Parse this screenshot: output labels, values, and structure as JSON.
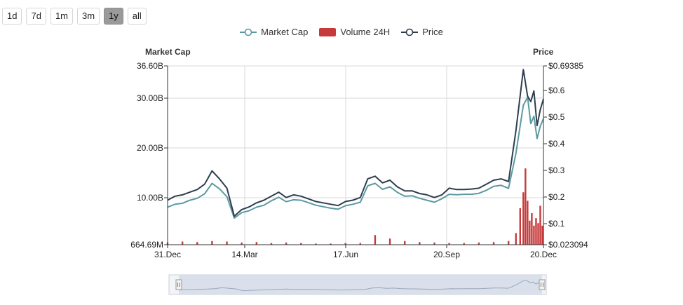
{
  "range_selector": {
    "buttons": [
      "1d",
      "7d",
      "1m",
      "3m",
      "1y",
      "all"
    ],
    "active": "1y"
  },
  "colors": {
    "market_cap": "#5b9aa0",
    "price": "#2e3d4f",
    "volume": "#c8393b",
    "grid": "#d8d8d8",
    "navigator_fill": "#d7dee9"
  },
  "chart_data": {
    "type": "line",
    "left_axis_title": "Market Cap",
    "right_axis_title": "Price",
    "x_ticks": [
      "31.Dec",
      "14.Mar",
      "17.Jun",
      "20.Sep",
      "20.Dec"
    ],
    "left_ticks": [
      "36.60B",
      "30.00B",
      "20.00B",
      "10.00B",
      "664.69M"
    ],
    "right_ticks": [
      "$0.69385",
      "$0.6",
      "$0.5",
      "$0.4",
      "$0.3",
      "$0.2",
      "$0.1",
      "$0.023094"
    ],
    "ylim_market_cap_billions": [
      0.66469,
      36.6
    ],
    "ylim_price_usd": [
      0.023094,
      0.69385
    ],
    "grid": true,
    "legend_position": "top-center",
    "series": [
      {
        "name": "Market Cap",
        "axis": "left",
        "unit": "B",
        "x_day": [
          0,
          7,
          14,
          21,
          28,
          35,
          42,
          49,
          56,
          63,
          70,
          77,
          84,
          91,
          98,
          105,
          112,
          119,
          126,
          133,
          140,
          147,
          154,
          161,
          168,
          175,
          182,
          189,
          196,
          203,
          210,
          217,
          224,
          231,
          238,
          245,
          252,
          259,
          266,
          273,
          280,
          287,
          294,
          301,
          308,
          315,
          322,
          329,
          336,
          340,
          343,
          346,
          349,
          352,
          355
        ],
        "values": [
          8.2,
          8.8,
          9.0,
          9.6,
          10.0,
          10.9,
          13.0,
          11.9,
          10.3,
          6.0,
          7.1,
          7.5,
          8.2,
          8.6,
          9.5,
          10.2,
          9.3,
          9.7,
          9.6,
          9.1,
          8.6,
          8.3,
          8.0,
          7.8,
          8.5,
          8.8,
          9.2,
          12.5,
          13.0,
          11.8,
          12.3,
          11.2,
          10.4,
          10.5,
          10.0,
          9.6,
          9.2,
          9.9,
          10.8,
          10.7,
          10.8,
          10.8,
          11.0,
          11.6,
          12.4,
          12.6,
          12.0,
          19.0,
          28.7,
          30.3,
          25.0,
          26.5,
          22.0,
          24.5,
          26.0
        ]
      },
      {
        "name": "Price",
        "axis": "right",
        "unit": "$",
        "x_day": [
          0,
          7,
          14,
          21,
          28,
          35,
          42,
          49,
          56,
          63,
          70,
          77,
          84,
          91,
          98,
          105,
          112,
          119,
          126,
          133,
          140,
          147,
          154,
          161,
          168,
          175,
          182,
          189,
          196,
          203,
          210,
          217,
          224,
          231,
          238,
          245,
          252,
          259,
          266,
          273,
          280,
          287,
          294,
          301,
          308,
          315,
          322,
          329,
          336,
          340,
          343,
          346,
          349,
          352,
          355
        ],
        "values": [
          0.19,
          0.205,
          0.21,
          0.22,
          0.23,
          0.25,
          0.3,
          0.27,
          0.235,
          0.13,
          0.155,
          0.165,
          0.18,
          0.19,
          0.205,
          0.22,
          0.2,
          0.21,
          0.205,
          0.195,
          0.185,
          0.18,
          0.175,
          0.17,
          0.185,
          0.19,
          0.2,
          0.27,
          0.28,
          0.255,
          0.265,
          0.24,
          0.225,
          0.225,
          0.215,
          0.21,
          0.2,
          0.21,
          0.235,
          0.23,
          0.23,
          0.232,
          0.235,
          0.25,
          0.265,
          0.27,
          0.26,
          0.45,
          0.68,
          0.58,
          0.56,
          0.6,
          0.47,
          0.53,
          0.57
        ]
      },
      {
        "name": "Volume 24H",
        "axis": "left",
        "unit": "B",
        "type": "bar",
        "x_day": [
          0,
          14,
          28,
          42,
          56,
          70,
          84,
          98,
          112,
          126,
          140,
          154,
          168,
          182,
          196,
          210,
          224,
          238,
          252,
          266,
          280,
          294,
          308,
          322,
          329,
          333,
          336,
          338,
          340,
          342,
          344,
          346,
          348,
          350,
          352,
          354
        ],
        "values": [
          1.1,
          1.3,
          1.2,
          1.4,
          1.3,
          1.1,
          1.2,
          1.0,
          1.1,
          1.0,
          0.9,
          0.9,
          1.0,
          1.0,
          2.6,
          1.9,
          1.4,
          1.2,
          1.1,
          1.0,
          1.0,
          1.1,
          1.2,
          1.4,
          3.0,
          8.0,
          11.2,
          16.0,
          9.5,
          5.5,
          7.0,
          4.5,
          6.0,
          5.0,
          8.5,
          4.5
        ]
      }
    ]
  }
}
